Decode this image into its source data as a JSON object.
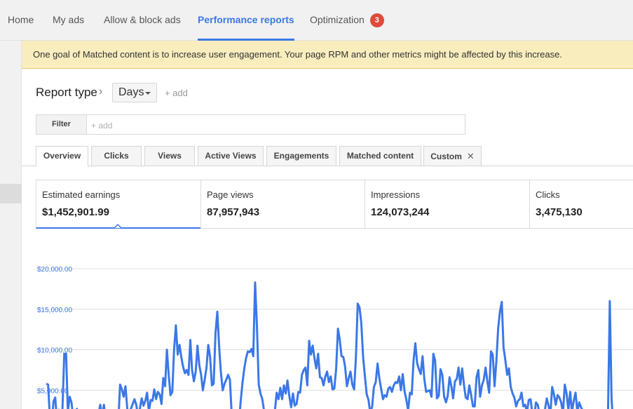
{
  "nav": {
    "tabs": [
      {
        "label": "Home"
      },
      {
        "label": "My ads"
      },
      {
        "label": "Allow & block ads"
      },
      {
        "label": "Performance reports"
      },
      {
        "label": "Optimization"
      }
    ],
    "active_tab": "Performance reports",
    "optimization_badge": "3"
  },
  "notice": {
    "text": "One goal of Matched content is to increase user engagement. Your page RPM and other metrics might be affected by this increase."
  },
  "report": {
    "type_label": "Report type",
    "type_value": "Days",
    "add_label": "+ add"
  },
  "filter": {
    "label": "Filter",
    "placeholder": "+ add"
  },
  "subtabs": [
    {
      "label": "Overview"
    },
    {
      "label": "Clicks"
    },
    {
      "label": "Views"
    },
    {
      "label": "Active Views"
    },
    {
      "label": "Engagements"
    },
    {
      "label": "Matched content"
    },
    {
      "label": "Custom"
    }
  ],
  "active_subtab": "Overview",
  "metrics": [
    {
      "label": "Estimated earnings",
      "value": "$1,452,901.99"
    },
    {
      "label": "Page views",
      "value": "87,957,943"
    },
    {
      "label": "Impressions",
      "value": "124,073,244"
    },
    {
      "label": "Clicks",
      "value": "3,475,130"
    }
  ],
  "active_metric": "Estimated earnings",
  "colors": {
    "accent": "#3b78e7",
    "badge": "#dd4b39",
    "notice_bg": "#f9edbe"
  },
  "chart_data": {
    "type": "line",
    "title": "",
    "xlabel": "",
    "ylabel": "",
    "y_ticks": [
      "$20,000.00",
      "$15,000.00",
      "$10,000.00",
      "$5,000.00"
    ],
    "ylim": [
      0,
      21500
    ],
    "grid": true,
    "series": [
      {
        "color": "#3b78e7",
        "values": [
          5800,
          5700,
          1800,
          700,
          3600,
          4100,
          1000,
          2600,
          1400,
          2700,
          9500,
          9500,
          2300,
          4200,
          3500,
          1500,
          900,
          2700,
          1400,
          600,
          800,
          700,
          600,
          300,
          1600,
          1300,
          1200,
          1100,
          500,
          2100,
          3200,
          1700,
          3200,
          1500,
          700,
          1300,
          1600,
          1600,
          1300,
          1900,
          900,
          5700,
          5100,
          4200,
          5500,
          2700,
          1500,
          2700,
          3300,
          3900,
          3200,
          1700,
          2700,
          4000,
          3100,
          3700,
          4700,
          2400,
          3800,
          3700,
          5100,
          3900,
          4800,
          4500,
          3300,
          6500,
          5500,
          10000,
          7000,
          4400,
          4800,
          10000,
          13000,
          9400,
          10600,
          9100,
          7900,
          7100,
          7500,
          6900,
          11200,
          7500,
          6100,
          7300,
          10500,
          8100,
          6900,
          5000,
          6300,
          7800,
          10600,
          9100,
          5600,
          5800,
          12000,
          14700,
          10400,
          7200,
          5000,
          5800,
          6300,
          6900,
          6300,
          2000,
          1000,
          1000,
          1300,
          1000,
          3700,
          5900,
          7700,
          9000,
          9800,
          9700,
          10100,
          9200,
          18300,
          13000,
          5700,
          4600,
          3900,
          2400,
          1800,
          1400,
          700,
          500,
          400,
          2500,
          4700,
          3900,
          5300,
          3900,
          5600,
          4600,
          6200,
          4300,
          2900,
          4600,
          3100,
          3300,
          4800,
          4700,
          6900,
          7500,
          7800,
          5600,
          11100,
          9400,
          10500,
          8900,
          7700,
          9500,
          6600,
          6500,
          5600,
          6700,
          7300,
          6000,
          6700,
          5100,
          5200,
          7600,
          12600,
          11300,
          9200,
          9100,
          7900,
          5500,
          6500,
          7300,
          5700,
          5100,
          9000,
          15700,
          15200,
          13300,
          9100,
          6700,
          4500,
          3800,
          2100,
          3000,
          5400,
          6000,
          8300,
          6500,
          5200,
          3900,
          4400,
          4200,
          5200,
          5400,
          4800,
          5600,
          6000,
          5900,
          6700,
          5000,
          7000,
          4900,
          3800,
          2500,
          4700,
          4500,
          8600,
          10800,
          8300,
          7600,
          7000,
          9200,
          6400,
          4800,
          4900,
          5000,
          4200,
          9500,
          8700,
          4000,
          4300,
          7600,
          6900,
          4200,
          3500,
          4300,
          6600,
          5500,
          4000,
          6100,
          6400,
          7800,
          5700,
          7700,
          5700,
          4100,
          3900,
          5600,
          4400,
          3000,
          3000,
          6600,
          7500,
          4200,
          5600,
          6300,
          7800,
          6100,
          4700,
          9800,
          9400,
          5500,
          8600,
          12600,
          14700,
          15900,
          10300,
          8700,
          6900,
          7700,
          5400,
          4600,
          4100,
          3000,
          3700,
          3900,
          4700,
          3000,
          3200,
          2300,
          3800,
          3900,
          2100,
          1700,
          3500,
          3200,
          2100,
          1400,
          1800,
          2600,
          4000,
          3100,
          2000,
          5400,
          4500,
          3200,
          4400,
          4100,
          3500,
          2200,
          5700,
          4600,
          2600,
          4800,
          2300,
          3700,
          4700,
          2300,
          3500,
          2900,
          2500,
          1800,
          2000,
          1500,
          1800,
          2300,
          1900,
          1600,
          1700,
          1400,
          1200,
          600,
          600,
          700,
          1900,
          16000,
          4000,
          200
        ]
      }
    ]
  }
}
